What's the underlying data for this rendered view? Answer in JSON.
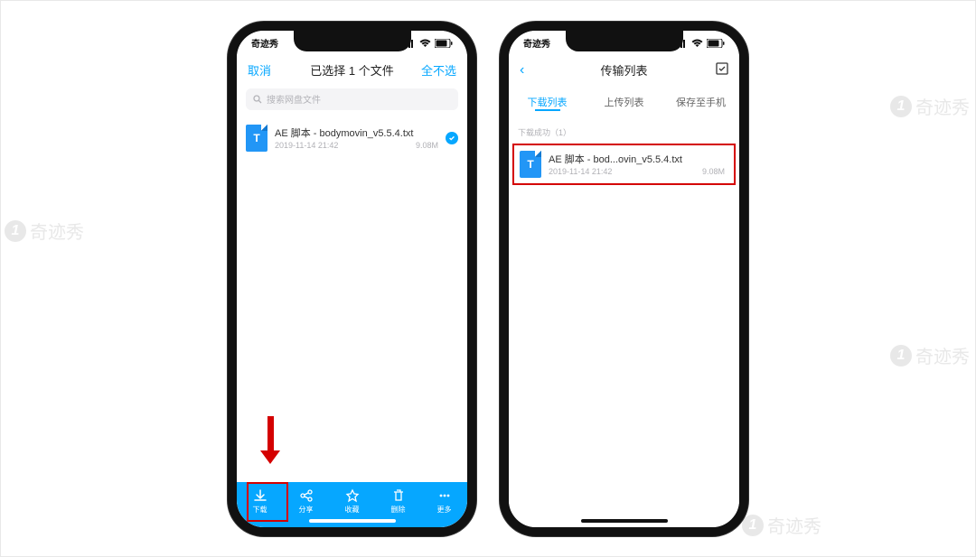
{
  "watermark_text": "奇迹秀",
  "status": {
    "carrier": "奇迹秀"
  },
  "left": {
    "nav": {
      "cancel": "取消",
      "title": "已选择 1 个文件",
      "deselect": "全不选"
    },
    "search_placeholder": "搜索网盘文件",
    "file": {
      "name": "AE 脚本 - bodymovin_v5.5.4.txt",
      "date": "2019-11-14 21:42",
      "size": "9.08M"
    },
    "toolbar": {
      "download": "下载",
      "share": "分享",
      "favorite": "收藏",
      "delete": "删除",
      "more": "更多"
    }
  },
  "right": {
    "nav": {
      "title": "传输列表"
    },
    "tabs": {
      "download": "下载列表",
      "upload": "上传列表",
      "save": "保存至手机"
    },
    "section": "下载成功（1）",
    "file": {
      "name": "AE 脚本 - bod...ovin_v5.5.4.txt",
      "date": "2019-11-14 21:42",
      "size": "9.08M"
    }
  }
}
